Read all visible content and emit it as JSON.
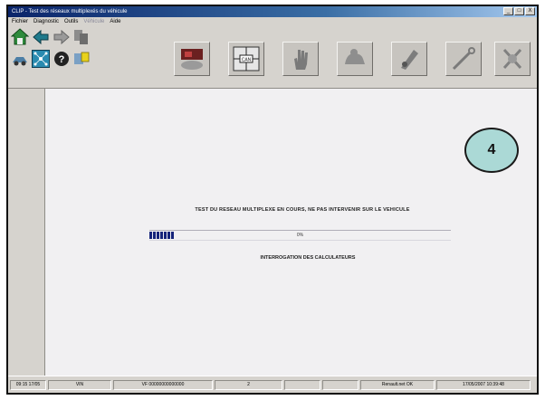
{
  "window": {
    "title": "CLIP - Test des réseaux multiplexés du véhicule",
    "controls": [
      "_",
      "□",
      "X"
    ]
  },
  "menu": [
    {
      "label": "Fichier",
      "enabled": true
    },
    {
      "label": "Diagnostic",
      "enabled": true
    },
    {
      "label": "Outils",
      "enabled": true
    },
    {
      "label": "Véhicule",
      "enabled": false
    },
    {
      "label": "Aide",
      "enabled": true
    }
  ],
  "toolbar": {
    "small_icons": [
      "home-icon",
      "back-arrow-icon",
      "forward-arrow-icon",
      "documents-icon",
      "car-parts-icon",
      "network-icon",
      "help-icon",
      "reports-icon"
    ],
    "big_buttons": [
      "vehicle-test-icon",
      "can-network-icon",
      "manual-hand-icon",
      "passenger-compartment-icon",
      "engine-parts-icon",
      "tool-icon",
      "repair-icon"
    ]
  },
  "main": {
    "step_badge": "4",
    "message": "TEST DU RESEAU MULTIPLEXE EN COURS, NE PAS INTERVENIR SUR LE VEHICULE",
    "progress": {
      "percent": 8,
      "label": "0%"
    },
    "submessage": "INTERROGATION DES CALCULATEURS"
  },
  "status_bar": [
    "09:15 17/05",
    "VIN",
    "VF 00000000000000",
    "2",
    "",
    "",
    "Renault.net OK",
    "17/05/2007 10:39:48"
  ],
  "colors": {
    "title_bar": "#0a246a",
    "badge": "#abd9d6",
    "progress_fill": "#15237a"
  }
}
